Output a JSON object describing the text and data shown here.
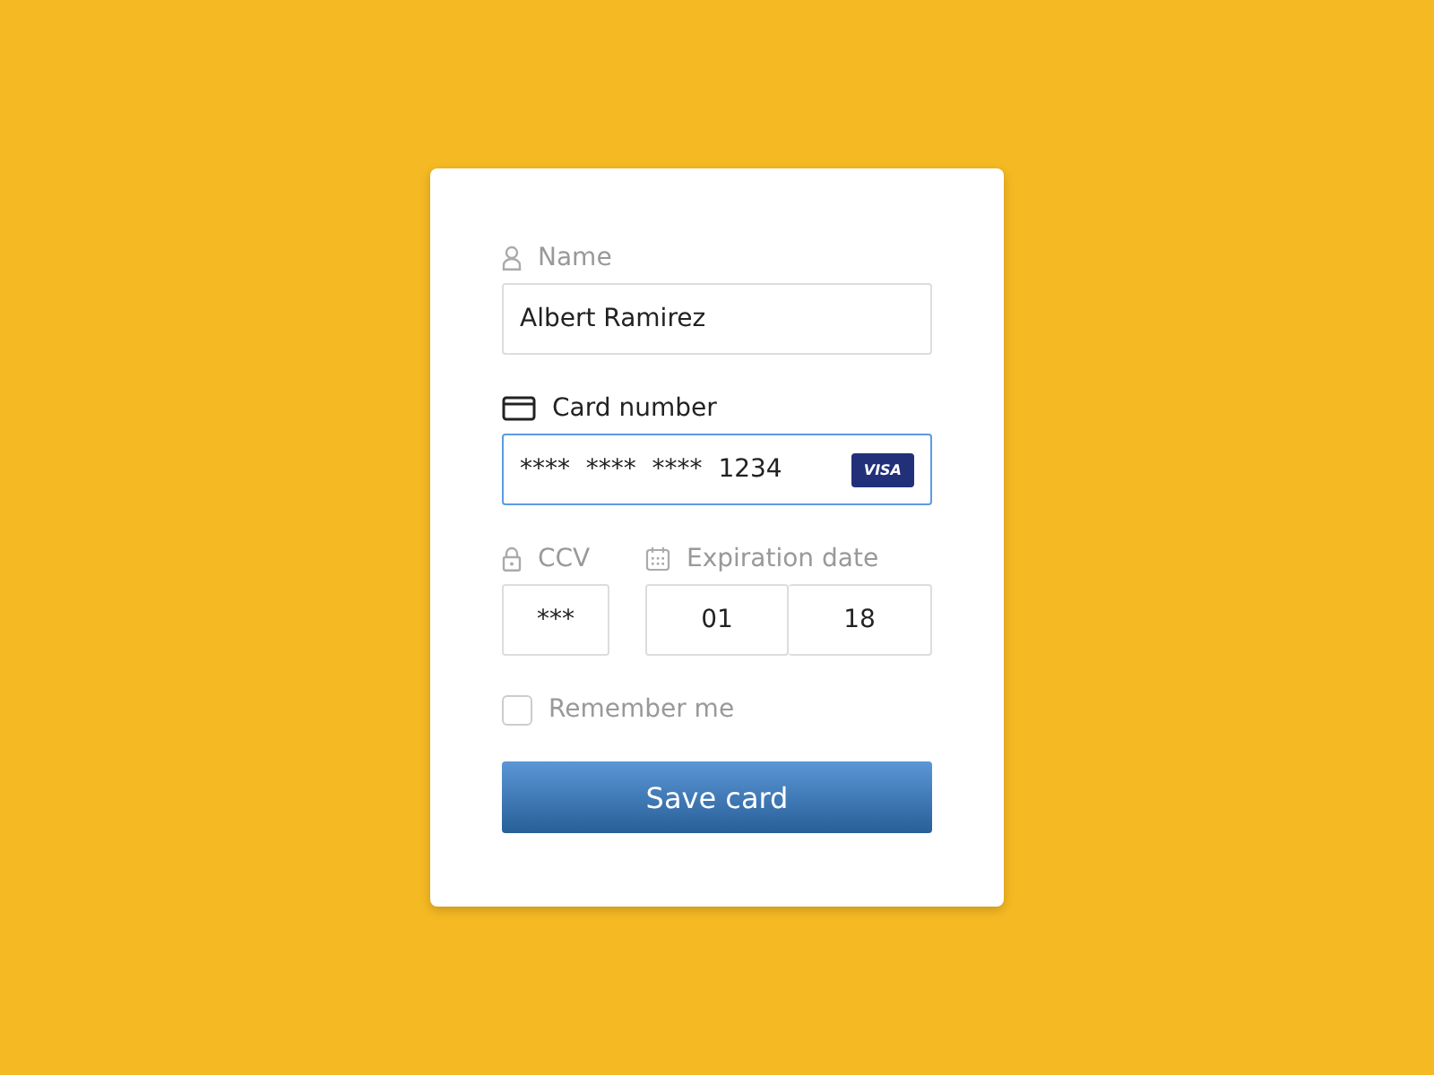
{
  "form": {
    "name": {
      "label": "Name",
      "value": "Albert Ramirez",
      "focused": false
    },
    "card_number": {
      "label": "Card number",
      "value": "****  ****  ****  1234",
      "brand": "VISA",
      "focused": true
    },
    "ccv": {
      "label": "CCV",
      "value": "***",
      "focused": false
    },
    "expiration": {
      "label": "Expiration date",
      "month": "01",
      "year": "18",
      "focused": false
    },
    "remember": {
      "label": "Remember me",
      "checked": false
    },
    "submit": "Save card"
  }
}
